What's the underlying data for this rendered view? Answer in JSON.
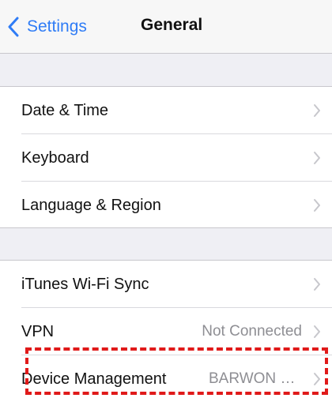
{
  "navbar": {
    "back_label": "Settings",
    "title": "General",
    "back_icon": "chevron-left-icon",
    "accent_color": "#2f7cf6"
  },
  "group1": {
    "rows": [
      {
        "label": "Date & Time",
        "value": ""
      },
      {
        "label": "Keyboard",
        "value": ""
      },
      {
        "label": "Language & Region",
        "value": ""
      }
    ]
  },
  "group2": {
    "rows": [
      {
        "label": "iTunes Wi-Fi Sync",
        "value": ""
      },
      {
        "label": "VPN",
        "value": "Not Connected"
      },
      {
        "label": "Device Management",
        "value": "BARWON H..."
      }
    ]
  },
  "row_icon": "chevron-right-icon",
  "highlight_color": "#e01a1a"
}
